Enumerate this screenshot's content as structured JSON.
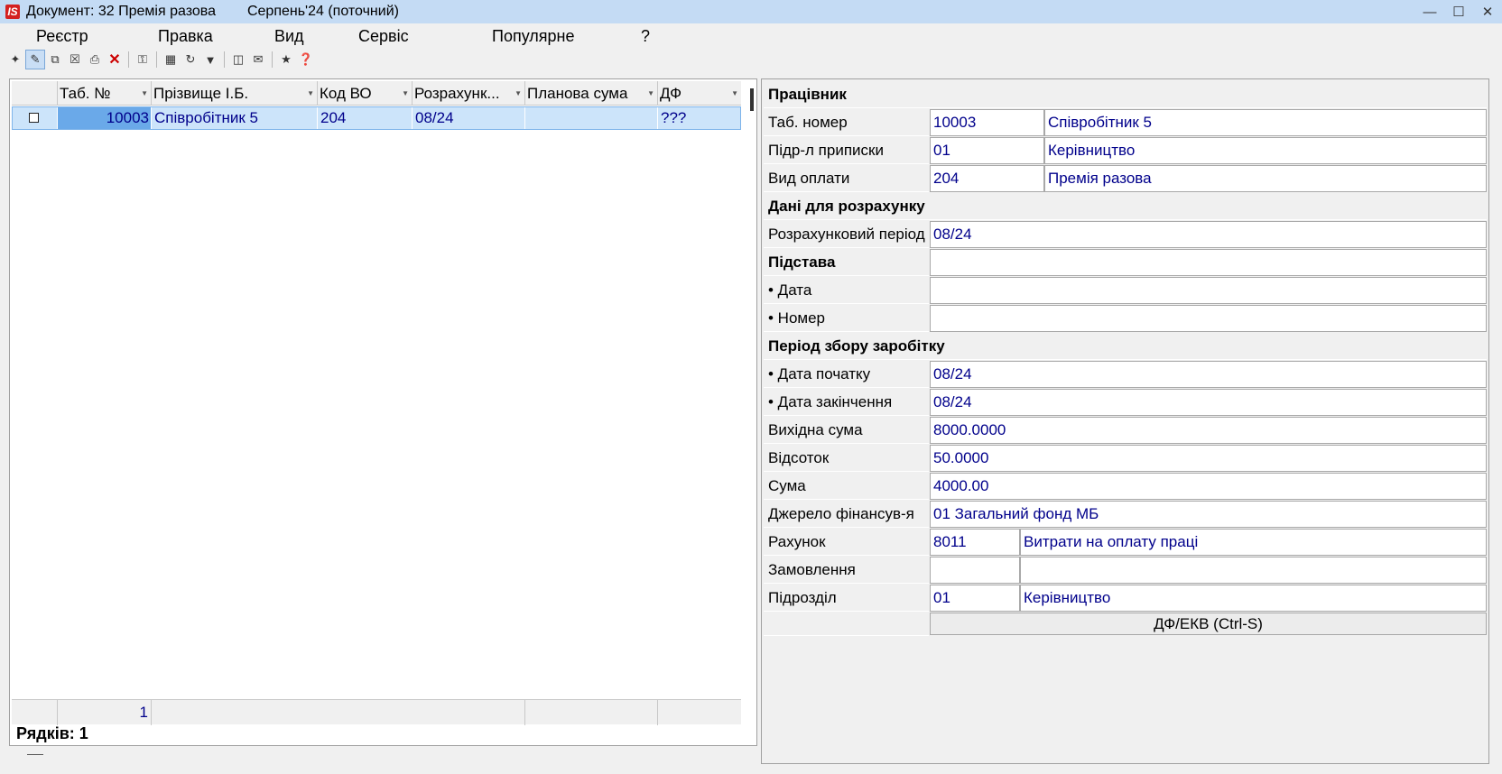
{
  "window": {
    "title": "Документ: 32 Премія разова",
    "period": "Серпень'24 (поточний)",
    "icon_letter": "IS"
  },
  "menu": [
    "Реєстр",
    "Правка",
    "Вид",
    "Сервіс",
    "Популярне",
    "?"
  ],
  "toolbar": {
    "icons": [
      "new-doc-icon",
      "edit-icon",
      "copy-icon",
      "delete-doc-icon",
      "print-icon",
      "delete-icon",
      "key-icon",
      "table-icon",
      "refresh-icon",
      "filter-icon",
      "page-icon",
      "mail-icon",
      "star-icon",
      "help-icon"
    ]
  },
  "grid": {
    "columns": [
      "Таб. №",
      "Прізвище І.Б.",
      "Код ВО",
      "Розрахунк...",
      "Планова сума",
      "ДФ"
    ],
    "rows": [
      {
        "tab": "10003",
        "name": "Співробітник 5",
        "code": "204",
        "period": "08/24",
        "plan_sum": "",
        "df": "???"
      }
    ],
    "footer_count": "1",
    "rows_label": "Рядків: 1"
  },
  "form": {
    "employee_section": "Працівник",
    "tab_number_label": "Таб. номер",
    "tab_number_value": "10003",
    "tab_number_name": "Співробітник 5",
    "dept_label": "Підр-л приписки",
    "dept_code": "01",
    "dept_name": "Керівництво",
    "pay_type_label": "Вид оплати",
    "pay_type_code": "204",
    "pay_type_name": "Премія разова",
    "calc_section": "Дані для розрахунку",
    "calc_period_label": "Розрахунковий період",
    "calc_period_value": "08/24",
    "basis_section": "Підстава",
    "basis_date_label": "• Дата",
    "basis_number_label": "• Номер",
    "earn_section": "Період збору заробітку",
    "start_label": "• Дата початку",
    "start_value": "08/24",
    "end_label": "• Дата закінчення",
    "end_value": "08/24",
    "base_sum_label": "Вихідна сума",
    "base_sum_value": "8000.0000",
    "percent_label": "Відсоток",
    "percent_value": "50.0000",
    "sum_label": "Сума",
    "sum_value": "4000.00",
    "fund_label": "Джерело фінансув-я",
    "fund_value": "01 Загальний фонд МБ",
    "account_label": "Рахунок",
    "account_code": "8011",
    "account_name": "Витрати на оплату праці",
    "order_label": "Замовлення",
    "unit_label": "Підрозділ",
    "unit_code": "01",
    "unit_name": "Керівництво",
    "df_button": "ДФ/ЕКВ (Ctrl-S)"
  }
}
